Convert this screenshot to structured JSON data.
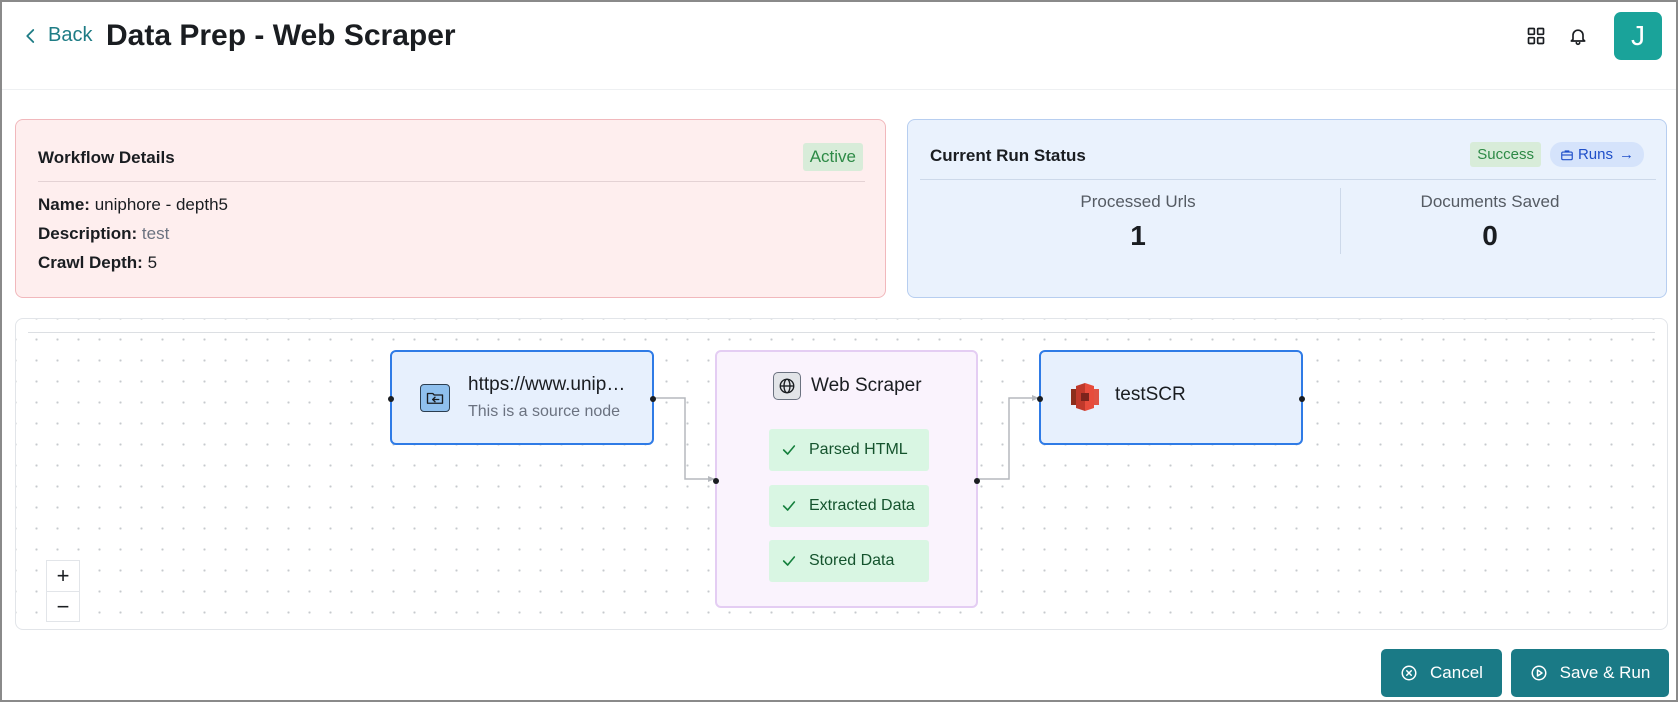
{
  "header": {
    "back_label": "Back",
    "title": "Data Prep - Web Scraper",
    "icons": [
      "grid-icon",
      "bell-icon"
    ],
    "avatar_initial": "J",
    "accent": "#1aa39a"
  },
  "workflow": {
    "title": "Workflow Details",
    "status": "Active",
    "name_label": "Name:",
    "name_value": "uniphore - depth5",
    "description_label": "Description:",
    "description_value": "test",
    "crawl_depth_label": "Crawl Depth:",
    "crawl_depth_value": "5"
  },
  "run_status": {
    "title": "Current Run Status",
    "status": "Success",
    "runs_label": "Runs",
    "processed_label": "Processed Urls",
    "processed_value": "1",
    "saved_label": "Documents Saved",
    "saved_value": "0"
  },
  "flow": {
    "source": {
      "title": "https://www.uniphore.com",
      "subtitle": "This is a source node"
    },
    "scraper": {
      "title": "Web Scraper",
      "steps": [
        "Parsed HTML",
        "Extracted Data",
        "Stored Data"
      ]
    },
    "destination": {
      "title": "testSCR"
    },
    "zoom_in": "+",
    "zoom_out": "−"
  },
  "footer": {
    "cancel_label": "Cancel",
    "save_run_label": "Save & Run",
    "button_color": "#1a7a86"
  }
}
